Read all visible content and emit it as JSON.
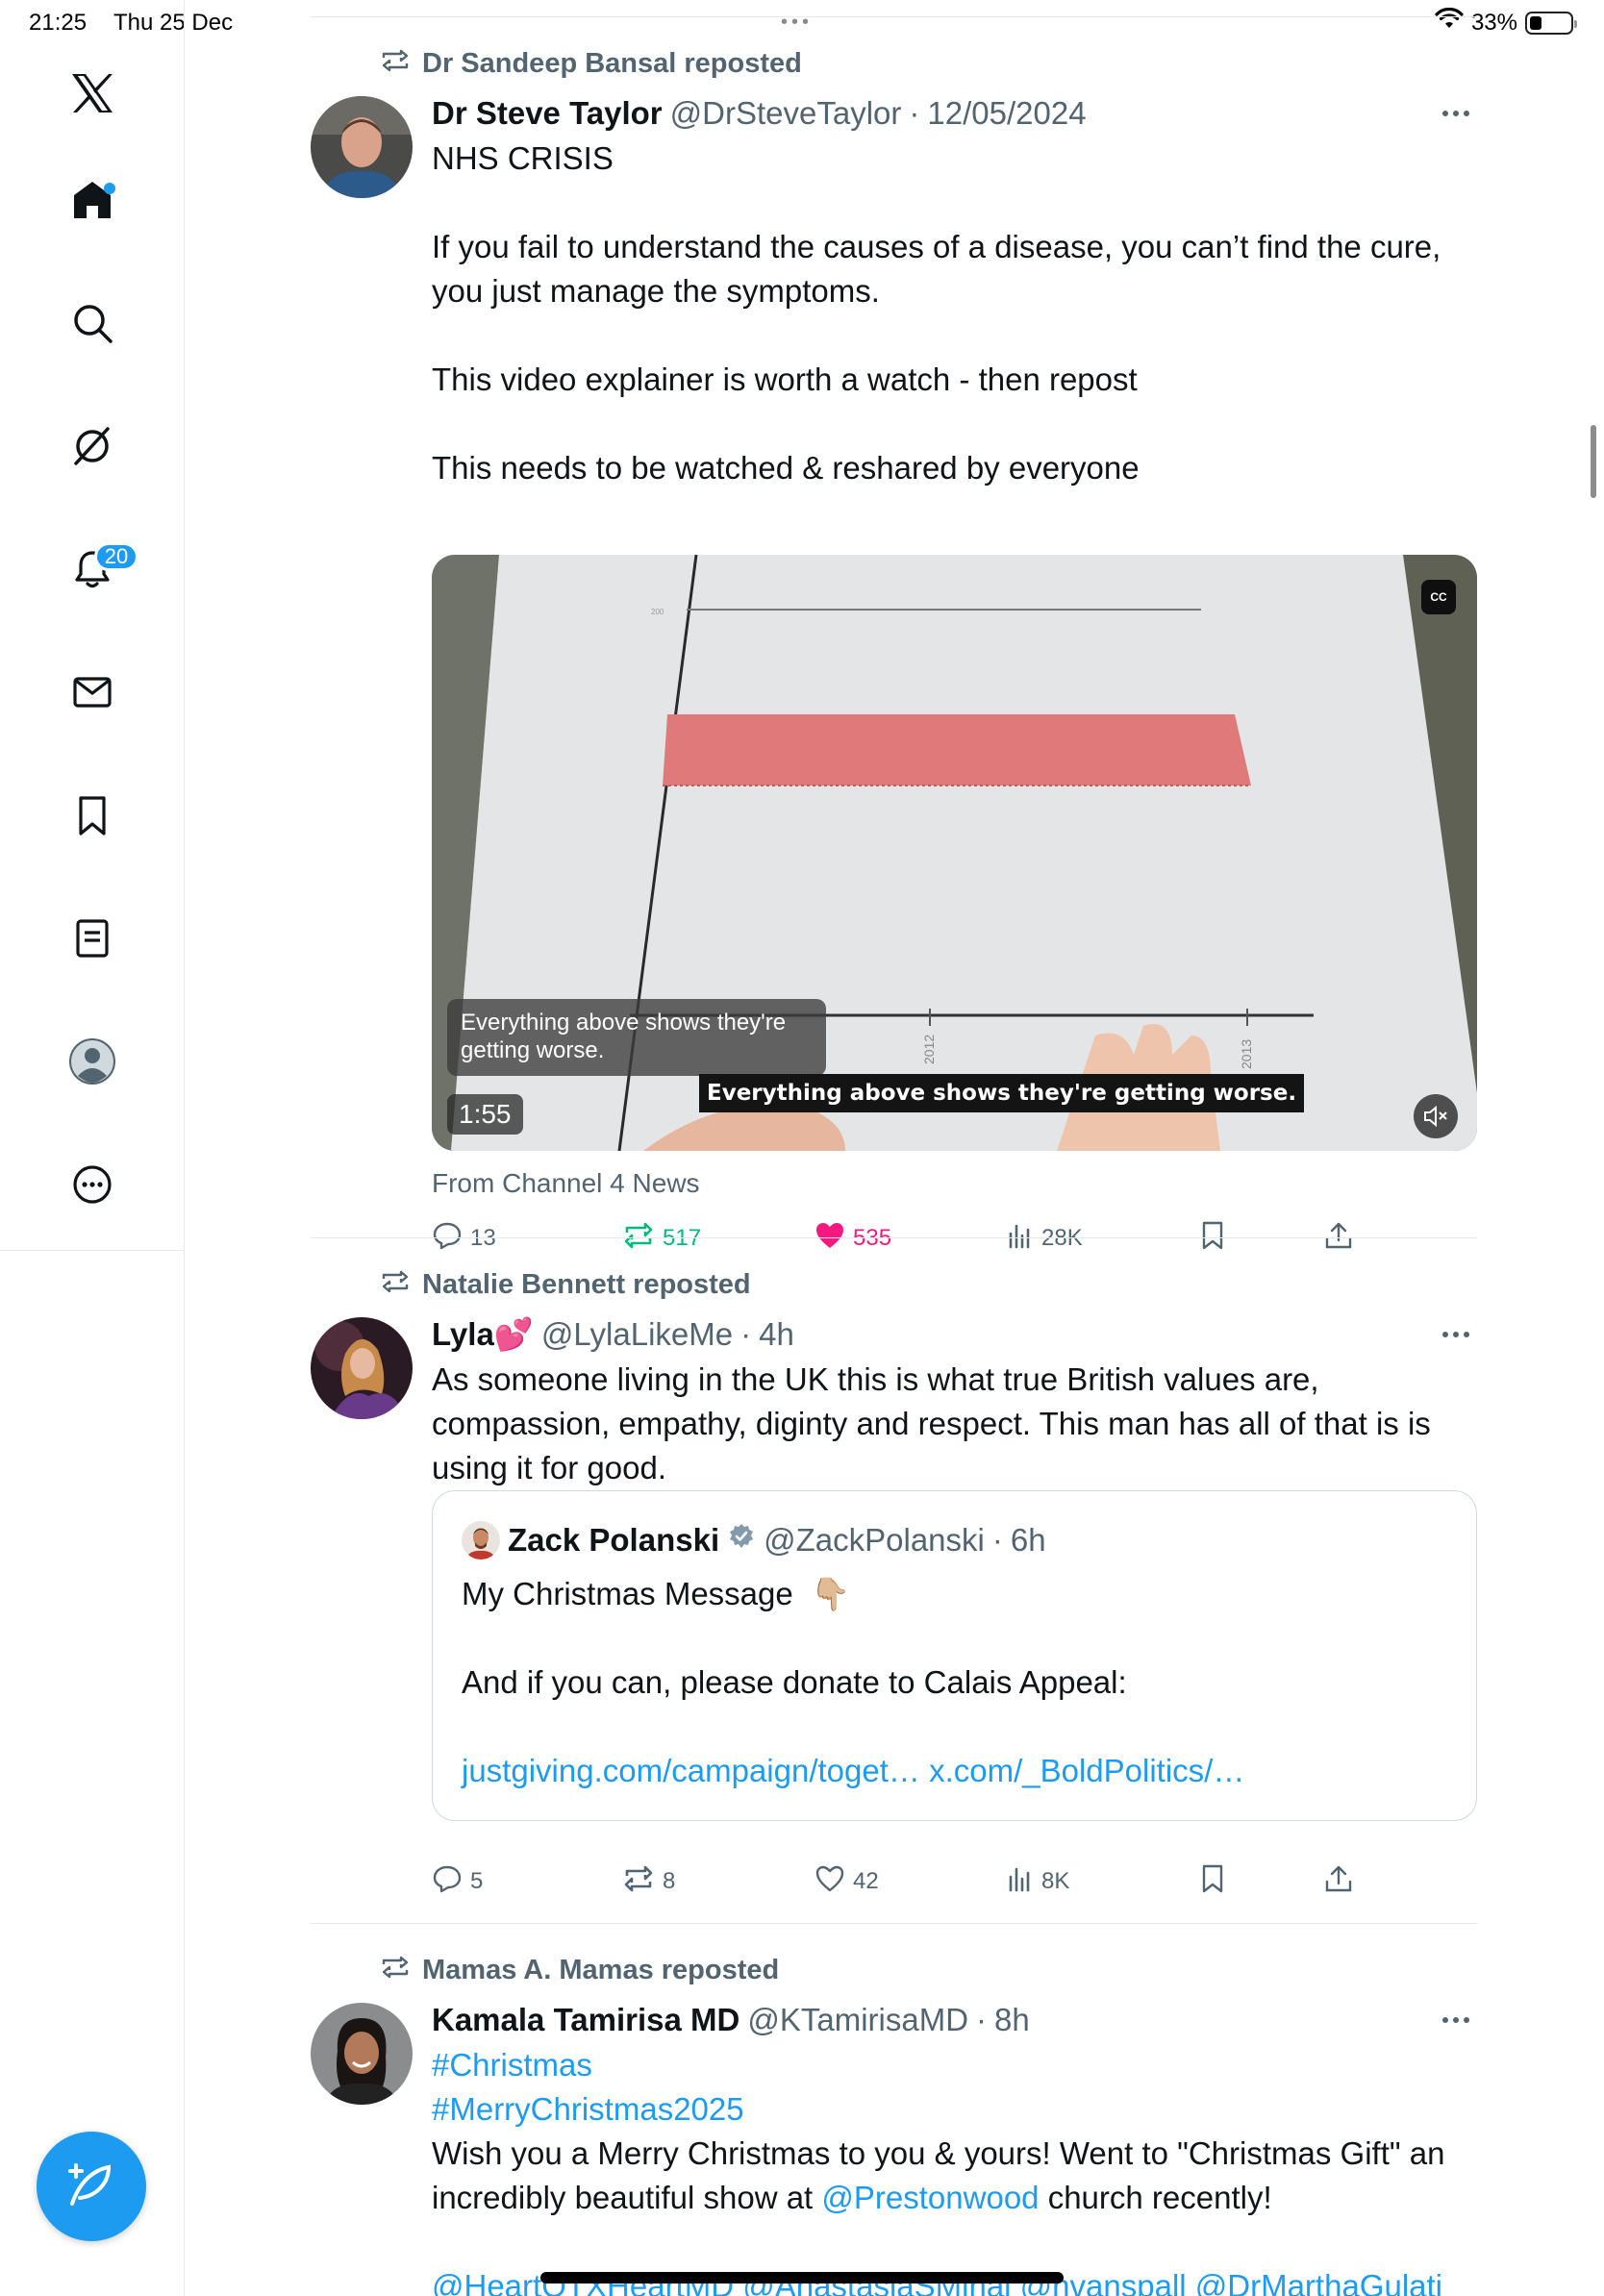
{
  "status_bar": {
    "time": "21:25",
    "date": "Thu 25 Dec",
    "battery": "33%",
    "battery_level": 0.33
  },
  "sidebar": {
    "items": [
      {
        "name": "x-logo"
      },
      {
        "name": "home",
        "has_dot": true
      },
      {
        "name": "search"
      },
      {
        "name": "grok"
      },
      {
        "name": "notifications",
        "badge": "20"
      },
      {
        "name": "messages"
      },
      {
        "name": "bookmarks"
      },
      {
        "name": "lists"
      },
      {
        "name": "profile"
      },
      {
        "name": "more"
      }
    ]
  },
  "colors": {
    "accent": "#1d9bf0",
    "like": "#f91880",
    "repost": "#00ba7c",
    "muted": "#536471"
  },
  "tweets": [
    {
      "reposted_by": "Dr Sandeep Bansal reposted",
      "name": "Dr Steve Taylor",
      "handle": "@DrSteveTaylor",
      "time": "12/05/2024",
      "lines": [
        "NHS CRISIS",
        "",
        "If you fail to understand the causes of a disease, you can’t find the cure, you just manage the symptoms.",
        "",
        "This video explainer is worth a watch - then repost",
        "",
        "This needs to be watched & reshared by everyone"
      ],
      "video": {
        "cc": "CC",
        "caption": "Everything above shows they're getting worse.",
        "subtitle": "Everything above shows they're getting worse.",
        "duration": "1:55",
        "axis_top_label": "200",
        "year_labels": [
          "2012",
          "2013"
        ]
      },
      "attribution": "From Channel 4 News",
      "stats": {
        "replies": "13",
        "reposts": "517",
        "likes": "535",
        "views": "28K"
      }
    },
    {
      "reposted_by": "Natalie Bennett reposted",
      "name": "Lyla💕",
      "handle": "@LylaLikeMe",
      "time": "4h",
      "text": "As someone living in the UK this is what true British values are, compassion, empathy, diginty and respect. This man has all of that is is using it for good.",
      "quote": {
        "name": "Zack Polanski",
        "handle": "@ZackPolanski",
        "time": "6h",
        "line1": "My Christmas Message",
        "emoji": "👇🏼",
        "line2": "And if you can, please donate to Calais Appeal:",
        "link1": "justgiving.com/campaign/toget…",
        "link2": "x.com/_BoldPolitics/…"
      },
      "stats": {
        "replies": "5",
        "reposts": "8",
        "likes": "42",
        "views": "8K"
      }
    },
    {
      "reposted_by": "Mamas A. Mamas reposted",
      "name": "Kamala Tamirisa MD",
      "handle": "@KTamirisaMD",
      "time": "8h",
      "hashtag1": "#Christmas",
      "hashtag2": "#MerryChristmas2025",
      "text_a": "Wish you a Merry Christmas to you & yours!  Went to \"Christmas Gift\" an incredibly beautiful show at ",
      "mention": "@Prestonwood",
      "text_b": " church recently!",
      "mentions_line": "@HeartOTXHeartMD @AnastasiaSMihai @hvanspall @DrMarthaGulati"
    }
  ]
}
